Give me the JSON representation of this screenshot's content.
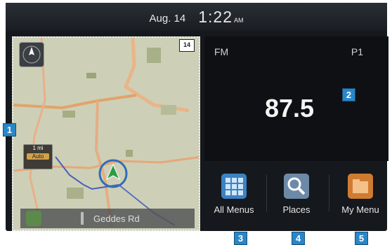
{
  "status_bar": {
    "date": "Aug. 14",
    "time": "1:22",
    "ampm": "AM"
  },
  "map": {
    "highway_shield": "14",
    "scale": {
      "distance": "1 mi",
      "mode": "Auto"
    },
    "current_road": "Geddes Rd"
  },
  "radio": {
    "band": "FM",
    "preset": "P1",
    "frequency": "87.5"
  },
  "shortcuts": [
    {
      "label": "All Menus",
      "icon": "grid-icon",
      "color": "#3b82c4"
    },
    {
      "label": "Places",
      "icon": "search-icon",
      "color": "#6c8aa8"
    },
    {
      "label": "My Menu",
      "icon": "folder-icon",
      "color": "#d07b30"
    }
  ],
  "callouts": [
    "1",
    "2",
    "3",
    "4",
    "5"
  ],
  "colors": {
    "callout": "#2a86c8",
    "screen_bg": "#15181c",
    "map_bg": "#cfd2b8",
    "route": "#e4a56a"
  }
}
